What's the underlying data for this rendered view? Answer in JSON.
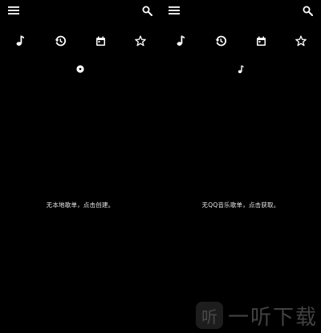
{
  "screens": [
    {
      "id": "local",
      "empty_message": "无本地歌单，点击创建。"
    },
    {
      "id": "qq",
      "empty_message": "无QQ音乐歌单，点击获取。"
    }
  ],
  "icons": {
    "menu": "menu-icon",
    "search": "search-icon",
    "tabs": [
      "music-note-icon",
      "history-icon",
      "calendar-icon",
      "star-icon"
    ],
    "indicator_left": "disc-icon",
    "indicator_right": "music-note-icon"
  },
  "watermark": {
    "logo_glyph": "听",
    "text": "一听下载"
  },
  "colors": {
    "background": "#000000",
    "foreground": "#ffffff"
  }
}
